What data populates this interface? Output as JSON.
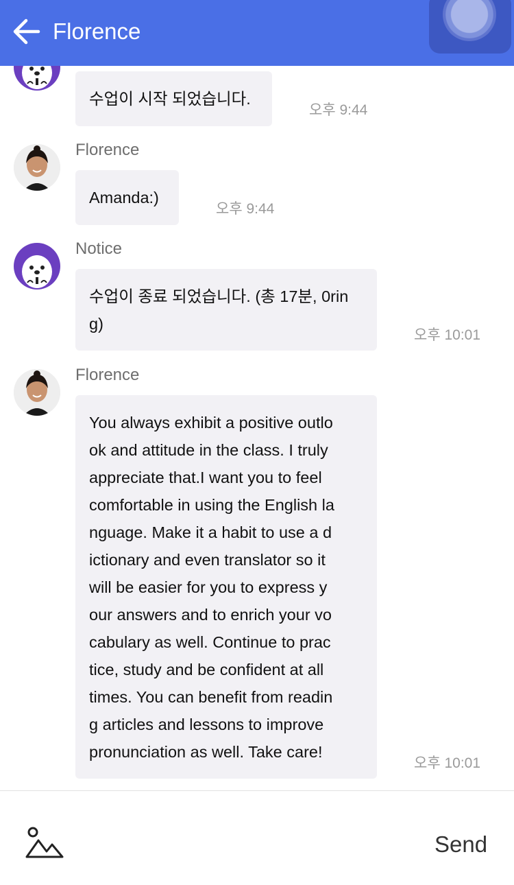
{
  "header": {
    "title": "Florence",
    "back_icon": "arrow-left-icon",
    "assist_icon": "floating-assist-icon",
    "color": "#4a6fe6"
  },
  "messages": [
    {
      "sender": "",
      "avatar": "notice-seal-avatar",
      "text": "수업이 시작 되었습니다.",
      "time": "오후 9:44"
    },
    {
      "sender": "Florence",
      "avatar": "florence-avatar",
      "text": "Amanda:)",
      "time": "오후 9:44"
    },
    {
      "sender": "Notice",
      "avatar": "notice-seal-avatar",
      "text": "수업이 종료 되었습니다. (총 17분, 0rin\ng)",
      "time": "오후 10:01"
    },
    {
      "sender": "Florence",
      "avatar": "florence-avatar",
      "text": "You always exhibit a positive outlo\nok and attitude in the class. I truly\nappreciate that.I want you to feel\ncomfortable in using the English la\nnguage. Make it a habit to use a d\nictionary and even translator so it\nwill be easier for you to express y\nour answers and to enrich your vo\ncabulary as well. Continue to prac\ntice, study and be confident at all\ntimes. You can benefit from readin\ng articles and lessons to improve\npronunciation as well. Take care!",
      "time": "오후 10:01"
    }
  ],
  "footer": {
    "send_label": "Send",
    "image_icon": "image-icon"
  }
}
